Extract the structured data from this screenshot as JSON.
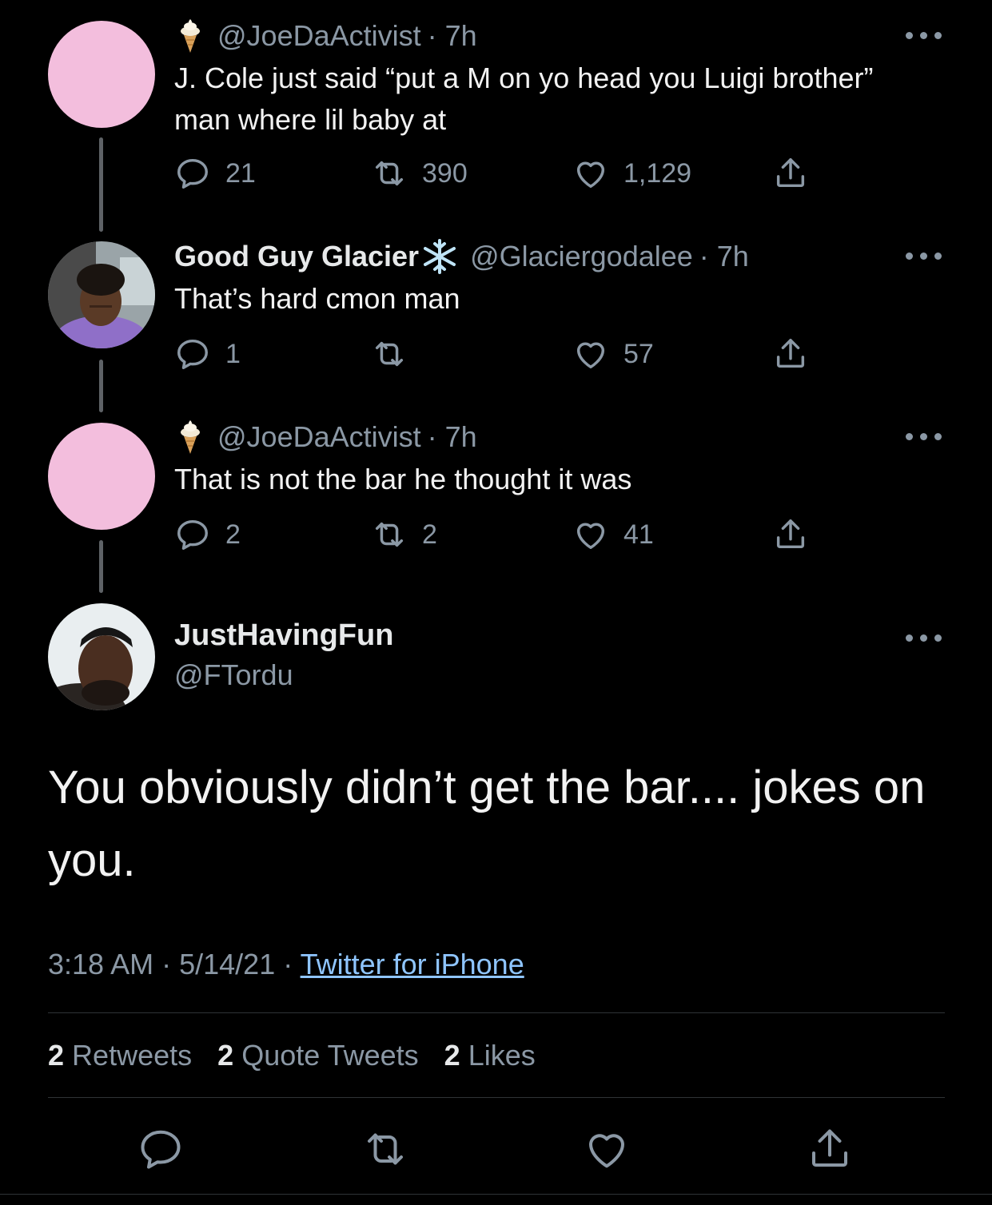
{
  "thread": [
    {
      "display_name": "",
      "handle": "@JoeDaActivist",
      "time": "· 7h",
      "text": "J. Cole just said “put a M on yo head you Luigi brother” man where lil baby at",
      "replies": "21",
      "retweets": "390",
      "likes": "1,129"
    },
    {
      "display_name": "Good Guy Glacier",
      "handle": "@Glaciergodalee",
      "time": "· 7h",
      "text": "That’s hard cmon man",
      "replies": "1",
      "retweets": "",
      "likes": "57"
    },
    {
      "display_name": "",
      "handle": "@JoeDaActivist",
      "time": "· 7h",
      "text": "That is not the bar he thought it was",
      "replies": "2",
      "retweets": "2",
      "likes": "41"
    }
  ],
  "main_tweet": {
    "display_name": "JustHavingFun",
    "handle": "@FTordu",
    "text": "You obviously didn’t get the bar.... jokes on you.",
    "time": "3:18 AM",
    "date": "5/14/21",
    "source": "Twitter for iPhone",
    "retweets_count": "2",
    "retweets_label": "Retweets",
    "quotes_count": "2",
    "quotes_label": "Quote Tweets",
    "likes_count": "2",
    "likes_label": "Likes"
  },
  "icons": {
    "reply": "reply-icon",
    "retweet": "retweet-icon",
    "like": "heart-icon",
    "share": "share-icon",
    "more": "more-icon",
    "badge": "ice-cream-emoji",
    "snowflake": "snowflake-emoji"
  },
  "colors": {
    "background": "#000000",
    "text": "#e7e9ea",
    "secondary": "#8b98a5",
    "link": "#8fc5ff",
    "avatar_placeholder": "#f3bedd"
  }
}
